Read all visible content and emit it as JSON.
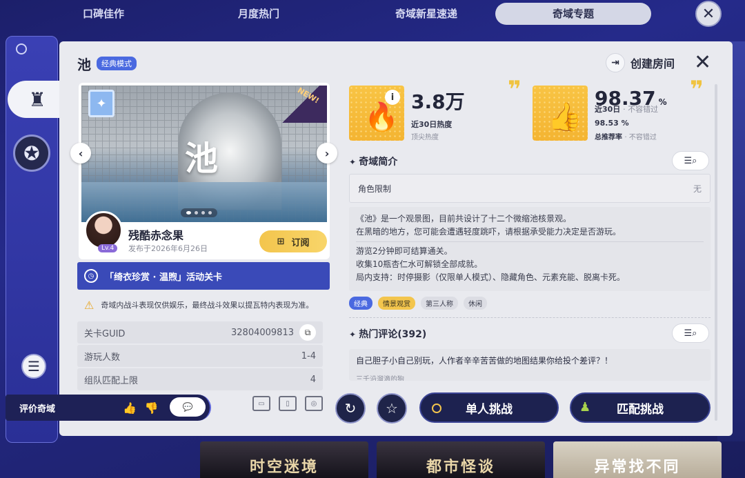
{
  "tabs": [
    {
      "label": "口碑佳作",
      "active": false
    },
    {
      "label": "月度热门",
      "active": false
    },
    {
      "label": "奇域新星速递",
      "active": false
    },
    {
      "label": "奇域专题",
      "active": true
    }
  ],
  "header": {
    "title": "池",
    "mode_badge": "经典模式",
    "create_room": "创建房间"
  },
  "preview": {
    "image_title": "池",
    "ribbon": "NEW!",
    "dots": 4,
    "active_dot": 0
  },
  "author": {
    "name": "残酷赤念果",
    "level": "Lv.4",
    "published": "发布于2026年6月26日",
    "subscribe": "订阅"
  },
  "event": {
    "label": "「绮衣珍赏 · 温煦」活动关卡"
  },
  "warning": {
    "text": "奇域内战斗表现仅供娱乐，最终战斗效果以提瓦特内表现为准。"
  },
  "info": [
    {
      "label": "关卡GUID",
      "value": "32804009813"
    },
    {
      "label": "游玩人数",
      "value": "1-4"
    },
    {
      "label": "组队匹配上限",
      "value": "4"
    }
  ],
  "stats": {
    "heat": {
      "value": "3.8万",
      "line1": "近30日热度",
      "line2": "顶尖热度"
    },
    "rating": {
      "value": "98.37",
      "unit": "%",
      "line1": "近30日",
      "line1_muted": "· 不容错过",
      "value2": "98.53 %",
      "line2": "总推荐率",
      "line2_muted": "· 不容错过"
    }
  },
  "intro": {
    "heading": "奇域简介",
    "limit_label": "角色限制",
    "limit_value": "无",
    "desc_lines_1": [
      "《池》是一个观景图，目前共设计了十二个微缩池核景观。",
      "在黑暗的地方，您可能会遭遇轻度跳吓，请根据承受能力决定是否游玩。"
    ],
    "desc_lines_2": [
      "游览2分钟即可结算通关。",
      "收集10瓶杏仁水可解锁全部成就。",
      "局内支持：时停摄影（仅限单人模式）、隐藏角色、元素充能、脱离卡死。"
    ],
    "tags": [
      "经典",
      "情景观赏",
      "第三人称",
      "休闲"
    ]
  },
  "comments": {
    "heading": "热门评论(392)",
    "first": "自己胆子小自己别玩，人作者辛辛苦苦做的地图结果你给投个差评？！",
    "first_author": "三千沿溜滴的狗"
  },
  "bottom": {
    "rate_label": "评价奇域",
    "single": "单人挑战",
    "match": "匹配挑战"
  },
  "cards": [
    "时空迷境",
    "都市怪谈",
    "异常找不同"
  ],
  "colors": {
    "accent": "#4a69e0",
    "gold": "#f3c54d",
    "navy": "#1d2250"
  }
}
